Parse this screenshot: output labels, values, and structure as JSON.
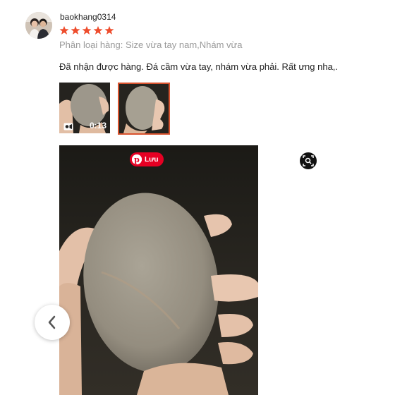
{
  "review": {
    "username": "baokhang0314",
    "rating": 5,
    "variation": "Phân loại hàng: Size vừa tay nam,Nhám vừa",
    "content": "Đã nhận được hàng. Đá cầm vừa tay, nhám vừa phải. Rất ưng nha,."
  },
  "thumbnails": [
    {
      "type": "video",
      "duration": "0:13"
    },
    {
      "type": "image",
      "selected": true
    }
  ],
  "viewer": {
    "pin_label": "Lưu",
    "pin_color": "#e60023"
  },
  "colors": {
    "star": "#ee4d2d",
    "selected_border": "#d9532f",
    "muted_text": "#9a9a9a"
  }
}
